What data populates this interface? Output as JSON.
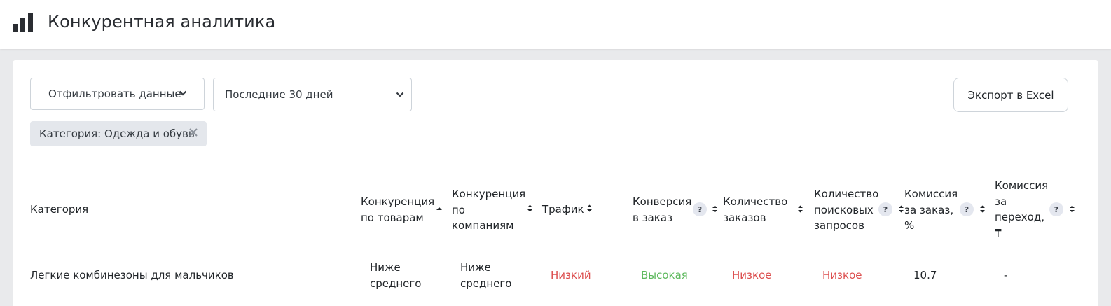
{
  "header": {
    "title": "Конкурентная аналитика"
  },
  "toolbar": {
    "filter_label": "Отфильтровать данные",
    "period_value": "Последние 30 дней",
    "export_label": "Экспорт в Excel"
  },
  "chip": {
    "label": "Категория: Одежда и обувь"
  },
  "table": {
    "headers": [
      "Категория",
      "Конкуренция по товарам",
      "Конкуренция по компаниям",
      "Трафик",
      "Конверсия в заказ",
      "Количество заказов",
      "Количество поисковых запросов",
      "Комиссия за заказ, %",
      "Комиссия за переход, ₸"
    ],
    "help_mark": "?",
    "rows": [
      {
        "category": "Легкие комбинезоны для мальчиков",
        "product_competition": "Ниже среднего",
        "company_competition": "Ниже среднего",
        "traffic": "Низкий",
        "conversion": "Высокая",
        "orders": "Низкое",
        "search_queries": "Низкое",
        "order_commission": "10.7",
        "click_commission": "-"
      }
    ]
  },
  "colors": {
    "low": "#dc4d4d",
    "high": "#5cb85c",
    "accent": "#2a2d32"
  },
  "icons": {
    "logo": "bar-chart-icon",
    "chevron": "chevron-down-icon",
    "close": "close-icon",
    "sort": "sort-icon",
    "sort_asc": "sort-asc-icon",
    "help": "help-icon"
  }
}
